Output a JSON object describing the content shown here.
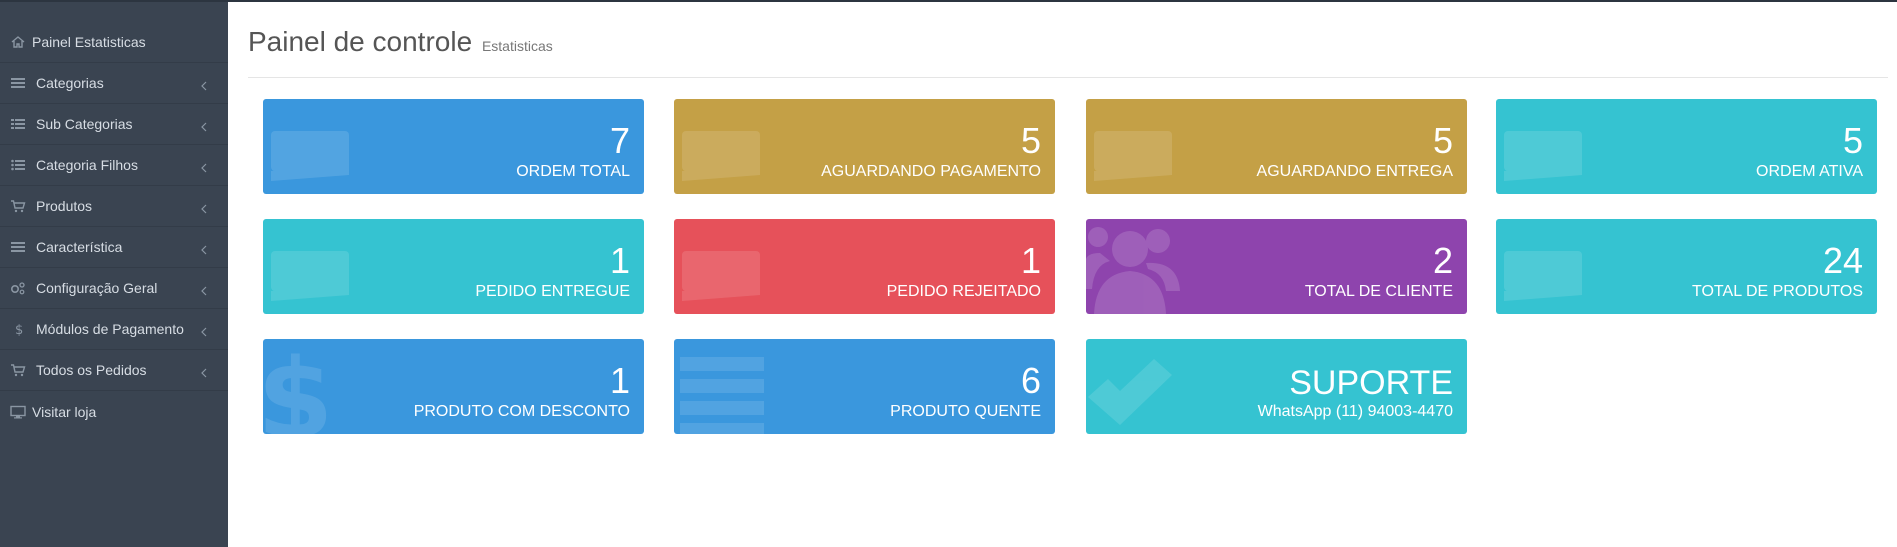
{
  "sidebar": {
    "items": [
      {
        "label": "Painel Estatisticas",
        "icon": "home-icon",
        "chevron": false
      },
      {
        "label": "Categorias",
        "icon": "bars-icon",
        "chevron": true
      },
      {
        "label": "Sub Categorias",
        "icon": "list-icon",
        "chevron": true
      },
      {
        "label": "Categoria Filhos",
        "icon": "list-ul-icon",
        "chevron": true
      },
      {
        "label": "Produtos",
        "icon": "cart-icon",
        "chevron": true
      },
      {
        "label": "Característica",
        "icon": "bars-icon",
        "chevron": true
      },
      {
        "label": "Configuração Geral",
        "icon": "cogs-icon",
        "chevron": true
      },
      {
        "label": "Módulos de Pagamento",
        "icon": "dollar-icon",
        "chevron": true
      },
      {
        "label": "Todos os Pedidos",
        "icon": "cart-icon",
        "chevron": true
      },
      {
        "label": "Visitar loja",
        "icon": "desktop-icon",
        "chevron": false
      }
    ]
  },
  "header": {
    "title": "Painel de controle",
    "subtitle": "Estatisticas"
  },
  "cards": [
    {
      "value": "7",
      "label": "ORDEM TOTAL",
      "color": "#3a97dd",
      "icon": "ticket-icon"
    },
    {
      "value": "5",
      "label": "AGUARDANDO PAGAMENTO",
      "color": "#c4a046",
      "icon": "ticket-icon"
    },
    {
      "value": "5",
      "label": "AGUARDANDO ENTREGA",
      "color": "#c4a046",
      "icon": "ticket-icon"
    },
    {
      "value": "5",
      "label": "ORDEM ATIVA",
      "color": "#35c3d1",
      "icon": "ticket-icon"
    },
    {
      "value": "1",
      "label": "PEDIDO ENTREGUE",
      "color": "#35c3d1",
      "icon": "ticket-icon"
    },
    {
      "value": "1",
      "label": "PEDIDO REJEITADO",
      "color": "#e6515a",
      "icon": "ticket-icon"
    },
    {
      "value": "2",
      "label": "TOTAL DE CLIENTE",
      "color": "#8e44ad",
      "icon": "users-icon"
    },
    {
      "value": "24",
      "label": "TOTAL DE PRODUTOS",
      "color": "#35c3d1",
      "icon": "ticket-icon"
    },
    {
      "value": "1",
      "label": "PRODUTO COM DESCONTO",
      "color": "#3a97dd",
      "icon": "dollar-icon"
    },
    {
      "value": "6",
      "label": "PRODUTO QUENTE",
      "color": "#3a97dd",
      "icon": "list-icon"
    },
    {
      "value": "SUPORTE",
      "label": "WhatsApp (11) 94003-4470",
      "color": "#35c3d1",
      "icon": "check-icon"
    }
  ]
}
